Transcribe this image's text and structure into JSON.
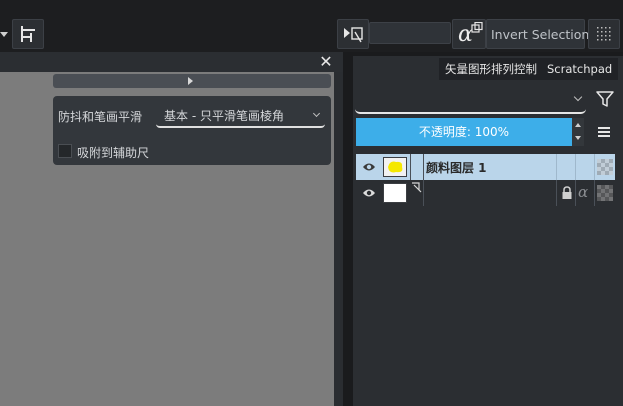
{
  "toolbar": {
    "invert_selection_label": "Invert Selection",
    "alpha_symbol": "α",
    "selection_input_value": ""
  },
  "canvas": {
    "close_symbol": "✕",
    "background_color": "#7c7c7c"
  },
  "tool_options": {
    "stabilizer_label": "防抖和笔画平滑",
    "stabilizer_value": "基本 - 只平滑笔画棱角",
    "snap_ruler_label": "吸附到辅助尺",
    "snap_ruler_checked": false
  },
  "dock": {
    "tabs": [
      {
        "label": "矢量图形排列控制"
      },
      {
        "label": "Scratchpad"
      }
    ],
    "blend_mode_value": "",
    "opacity_label": "不透明度:  100%",
    "accent_color": "#3daee9"
  },
  "layers": [
    {
      "name": "颜料图层 1",
      "selected": true,
      "thumb": "yellow-paint",
      "locked": false
    },
    {
      "name": "",
      "selected": false,
      "thumb": "white",
      "locked": true
    }
  ]
}
